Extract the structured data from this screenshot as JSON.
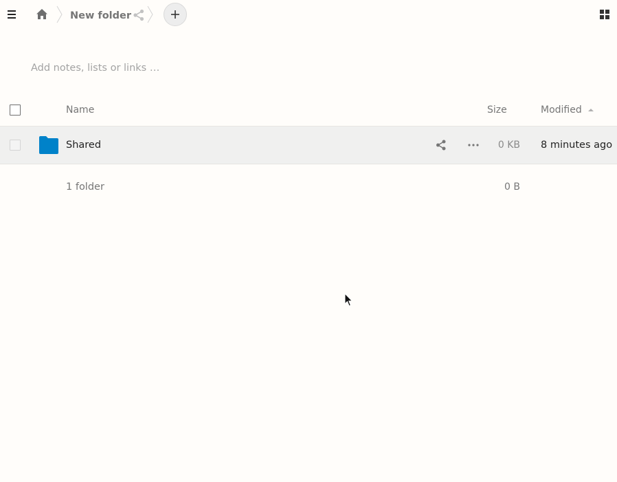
{
  "topbar": {
    "icons": {
      "menu": "hamburger-menu-icon",
      "home": "home-icon",
      "share": "share-icon",
      "new": "plus-icon",
      "view": "grid-view-icon"
    },
    "breadcrumb_current": "New folder"
  },
  "rich_workspace": {
    "placeholder": "Add notes, lists or links …"
  },
  "table": {
    "columns": {
      "name": "Name",
      "size": "Size",
      "modified": "Modified"
    },
    "sort": {
      "column": "modified",
      "direction": "ascending"
    },
    "rows": [
      {
        "icon": "folder-icon",
        "icon_color": "#0082c9",
        "name": "Shared",
        "size": "0 KB",
        "modified": "8 minutes ago",
        "actions": [
          "share-icon",
          "more-icon"
        ]
      }
    ],
    "summary": {
      "count": "1 folder",
      "size": "0 B"
    }
  },
  "colors": {
    "background": "#fffdfa",
    "row_hover": "#f0f0ef",
    "folder": "#0082c9",
    "muted_text": "#767676"
  }
}
